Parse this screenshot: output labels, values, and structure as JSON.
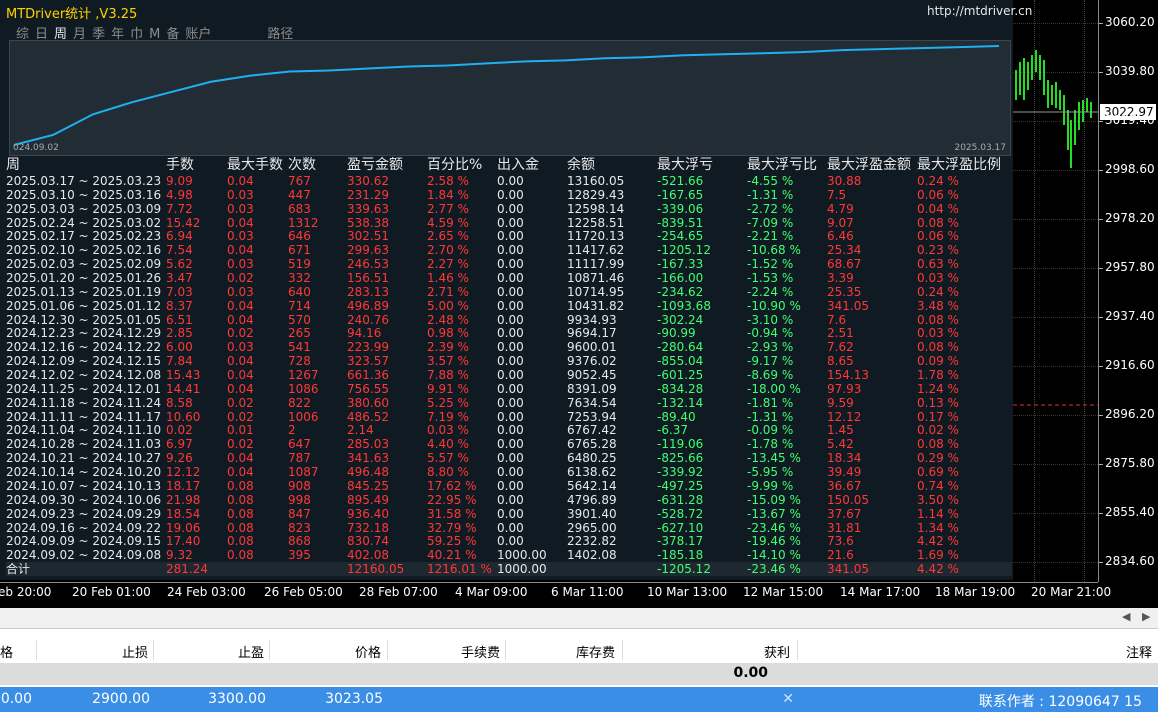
{
  "panel": {
    "title": "MTDriver统计 ,V3.25",
    "url": "http://mtdriver.cn",
    "tabs": [
      "综",
      "日",
      "周",
      "月",
      "季",
      "年",
      "巾",
      "M",
      "备",
      "账户",
      "路径"
    ],
    "equity_start": "024.09.02",
    "equity_end": "2025.03.17"
  },
  "equity_curve": [
    [
      0,
      0.0
    ],
    [
      0.04,
      0.1
    ],
    [
      0.08,
      0.3
    ],
    [
      0.12,
      0.42
    ],
    [
      0.16,
      0.52
    ],
    [
      0.2,
      0.62
    ],
    [
      0.24,
      0.68
    ],
    [
      0.28,
      0.72
    ],
    [
      0.32,
      0.73
    ],
    [
      0.36,
      0.75
    ],
    [
      0.4,
      0.77
    ],
    [
      0.44,
      0.78
    ],
    [
      0.48,
      0.8
    ],
    [
      0.52,
      0.82
    ],
    [
      0.56,
      0.83
    ],
    [
      0.6,
      0.85
    ],
    [
      0.64,
      0.86
    ],
    [
      0.68,
      0.88
    ],
    [
      0.72,
      0.89
    ],
    [
      0.76,
      0.9
    ],
    [
      0.8,
      0.91
    ],
    [
      0.84,
      0.93
    ],
    [
      0.88,
      0.94
    ],
    [
      0.92,
      0.95
    ],
    [
      0.96,
      0.96
    ],
    [
      1.0,
      0.97
    ]
  ],
  "stats": {
    "headers": [
      "周",
      "手数",
      "最大手数",
      "次数",
      "盈亏金额",
      "百分比%",
      "出入金",
      "余额",
      "最大浮亏",
      "最大浮亏比",
      "最大浮盈金额",
      "最大浮盈比例"
    ],
    "rows": [
      [
        "2025.03.17 ~ 2025.03.23",
        "9.09",
        "0.04",
        "767",
        "330.62",
        "2.58 %",
        "0.00",
        "13160.05",
        "-521.66",
        "-4.55 %",
        "30.88",
        "0.24 %"
      ],
      [
        "2025.03.10 ~ 2025.03.16",
        "4.98",
        "0.03",
        "447",
        "231.29",
        "1.84 %",
        "0.00",
        "12829.43",
        "-167.65",
        "-1.31 %",
        "7.5",
        "0.06 %"
      ],
      [
        "2025.03.03 ~ 2025.03.09",
        "7.72",
        "0.03",
        "683",
        "339.63",
        "2.77 %",
        "0.00",
        "12598.14",
        "-339.06",
        "-2.72 %",
        "4.79",
        "0.04 %"
      ],
      [
        "2025.02.24 ~ 2025.03.02",
        "15.42",
        "0.04",
        "1312",
        "538.38",
        "4.59 %",
        "0.00",
        "12258.51",
        "-839.51",
        "-7.09 %",
        "9.07",
        "0.08 %"
      ],
      [
        "2025.02.17 ~ 2025.02.23",
        "6.94",
        "0.03",
        "646",
        "302.51",
        "2.65 %",
        "0.00",
        "11720.13",
        "-254.65",
        "-2.21 %",
        "6.46",
        "0.06 %"
      ],
      [
        "2025.02.10 ~ 2025.02.16",
        "7.54",
        "0.04",
        "671",
        "299.63",
        "2.70 %",
        "0.00",
        "11417.62",
        "-1205.12",
        "-10.68 %",
        "25.34",
        "0.23 %"
      ],
      [
        "2025.02.03 ~ 2025.02.09",
        "5.62",
        "0.03",
        "519",
        "246.53",
        "2.27 %",
        "0.00",
        "11117.99",
        "-167.33",
        "-1.52 %",
        "68.67",
        "0.63 %"
      ],
      [
        "2025.01.20 ~ 2025.01.26",
        "3.47",
        "0.02",
        "332",
        "156.51",
        "1.46 %",
        "0.00",
        "10871.46",
        "-166.00",
        "-1.53 %",
        "3.39",
        "0.03 %"
      ],
      [
        "2025.01.13 ~ 2025.01.19",
        "7.03",
        "0.03",
        "640",
        "283.13",
        "2.71 %",
        "0.00",
        "10714.95",
        "-234.62",
        "-2.24 %",
        "25.35",
        "0.24 %"
      ],
      [
        "2025.01.06 ~ 2025.01.12",
        "8.37",
        "0.04",
        "714",
        "496.89",
        "5.00 %",
        "0.00",
        "10431.82",
        "-1093.68",
        "-10.90 %",
        "341.05",
        "3.48 %"
      ],
      [
        "2024.12.30 ~ 2025.01.05",
        "6.51",
        "0.04",
        "570",
        "240.76",
        "2.48 %",
        "0.00",
        "9934.93",
        "-302.24",
        "-3.10 %",
        "7.6",
        "0.08 %"
      ],
      [
        "2024.12.23 ~ 2024.12.29",
        "2.85",
        "0.02",
        "265",
        "94.16",
        "0.98 %",
        "0.00",
        "9694.17",
        "-90.99",
        "-0.94 %",
        "2.51",
        "0.03 %"
      ],
      [
        "2024.12.16 ~ 2024.12.22",
        "6.00",
        "0.03",
        "541",
        "223.99",
        "2.39 %",
        "0.00",
        "9600.01",
        "-280.64",
        "-2.93 %",
        "7.62",
        "0.08 %"
      ],
      [
        "2024.12.09 ~ 2024.12.15",
        "7.84",
        "0.04",
        "728",
        "323.57",
        "3.57 %",
        "0.00",
        "9376.02",
        "-855.04",
        "-9.17 %",
        "8.65",
        "0.09 %"
      ],
      [
        "2024.12.02 ~ 2024.12.08",
        "15.43",
        "0.04",
        "1267",
        "661.36",
        "7.88 %",
        "0.00",
        "9052.45",
        "-601.25",
        "-8.69 %",
        "154.13",
        "1.78 %"
      ],
      [
        "2024.11.25 ~ 2024.12.01",
        "14.41",
        "0.04",
        "1086",
        "756.55",
        "9.91 %",
        "0.00",
        "8391.09",
        "-834.28",
        "-18.00 %",
        "97.93",
        "1.24 %"
      ],
      [
        "2024.11.18 ~ 2024.11.24",
        "8.58",
        "0.02",
        "822",
        "380.60",
        "5.25 %",
        "0.00",
        "7634.54",
        "-132.14",
        "-1.81 %",
        "9.59",
        "0.13 %"
      ],
      [
        "2024.11.11 ~ 2024.11.17",
        "10.60",
        "0.02",
        "1006",
        "486.52",
        "7.19 %",
        "0.00",
        "7253.94",
        "-89.40",
        "-1.31 %",
        "12.12",
        "0.17 %"
      ],
      [
        "2024.11.04 ~ 2024.11.10",
        "0.02",
        "0.01",
        "2",
        "2.14",
        "0.03 %",
        "0.00",
        "6767.42",
        "-6.37",
        "-0.09 %",
        "1.45",
        "0.02 %"
      ],
      [
        "2024.10.28 ~ 2024.11.03",
        "6.97",
        "0.02",
        "647",
        "285.03",
        "4.40 %",
        "0.00",
        "6765.28",
        "-119.06",
        "-1.78 %",
        "5.42",
        "0.08 %"
      ],
      [
        "2024.10.21 ~ 2024.10.27",
        "9.26",
        "0.04",
        "787",
        "341.63",
        "5.57 %",
        "0.00",
        "6480.25",
        "-825.66",
        "-13.45 %",
        "18.34",
        "0.29 %"
      ],
      [
        "2024.10.14 ~ 2024.10.20",
        "12.12",
        "0.04",
        "1087",
        "496.48",
        "8.80 %",
        "0.00",
        "6138.62",
        "-339.92",
        "-5.95 %",
        "39.49",
        "0.69 %"
      ],
      [
        "2024.10.07 ~ 2024.10.13",
        "18.17",
        "0.08",
        "908",
        "845.25",
        "17.62 %",
        "0.00",
        "5642.14",
        "-497.25",
        "-9.99 %",
        "36.67",
        "0.74 %"
      ],
      [
        "2024.09.30 ~ 2024.10.06",
        "21.98",
        "0.08",
        "998",
        "895.49",
        "22.95 %",
        "0.00",
        "4796.89",
        "-631.28",
        "-15.09 %",
        "150.05",
        "3.50 %"
      ],
      [
        "2024.09.23 ~ 2024.09.29",
        "18.54",
        "0.08",
        "847",
        "936.40",
        "31.58 %",
        "0.00",
        "3901.40",
        "-528.72",
        "-13.67 %",
        "37.67",
        "1.14 %"
      ],
      [
        "2024.09.16 ~ 2024.09.22",
        "19.06",
        "0.08",
        "823",
        "732.18",
        "32.79 %",
        "0.00",
        "2965.00",
        "-627.10",
        "-23.46 %",
        "31.81",
        "1.34 %"
      ],
      [
        "2024.09.09 ~ 2024.09.15",
        "17.40",
        "0.08",
        "868",
        "830.74",
        "59.25 %",
        "0.00",
        "2232.82",
        "-378.17",
        "-19.46 %",
        "73.6",
        "4.42 %"
      ],
      [
        "2024.09.02 ~ 2024.09.08",
        "9.32",
        "0.08",
        "395",
        "402.08",
        "40.21 %",
        "1000.00",
        "1402.08",
        "-185.18",
        "-14.10 %",
        "21.6",
        "1.69 %"
      ]
    ],
    "total": [
      "合计",
      "281.24",
      "",
      "",
      "12160.05",
      "1216.01 %",
      "1000.00",
      "",
      "-1205.12",
      "-23.46 %",
      "341.05",
      "4.42 %"
    ]
  },
  "price_axis": {
    "labels": [
      "3060.20",
      "3039.80",
      "3019.40",
      "2998.60",
      "2978.20",
      "2957.80",
      "2937.40",
      "2916.60",
      "2896.20",
      "2875.80",
      "2855.40",
      "2834.60"
    ],
    "current": "3022.97"
  },
  "time_axis": [
    "eb 20:00",
    "20 Feb 01:00",
    "24 Feb 03:00",
    "26 Feb 05:00",
    "28 Feb 07:00",
    "4 Mar 09:00",
    "6 Mar 11:00",
    "10 Mar 13:00",
    "12 Mar 15:00",
    "14 Mar 17:00",
    "18 Mar 19:00",
    "20 Mar 21:00"
  ],
  "terminal": {
    "columns": [
      "格",
      "止损",
      "止盈",
      "价格",
      "手续费",
      "库存费",
      "获利",
      "注释"
    ],
    "sum_profit": "0.00",
    "order": {
      "col0": "0.00",
      "sl": "2900.00",
      "tp": "3300.00",
      "price": "3023.05",
      "comment": "联系作者 : 12090647 15"
    }
  },
  "colors": {
    "equity_line": "#1fb0f0",
    "candle": "#22dd22",
    "price_bg": "#000000",
    "selected": "#3a8ee6"
  }
}
